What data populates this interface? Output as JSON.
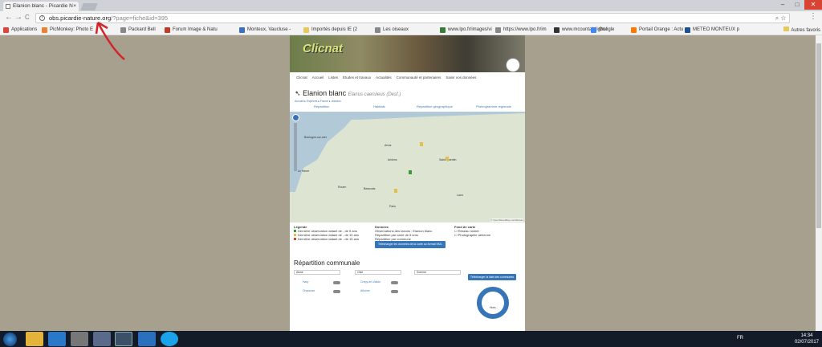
{
  "browser": {
    "tab_title": "Elanion blanc - Picardie N",
    "tab_close": "×",
    "address_host": "obs.picardie-nature.org",
    "address_rest": "/?page=fiche&id=395",
    "back_glyph": "←",
    "forward_glyph": "→",
    "reload_glyph": "C",
    "menu_glyph": "⋮",
    "omni_icons": "⌕ ☆",
    "win_min": "–",
    "win_max": "□",
    "win_close": "✕"
  },
  "bookmarks": [
    {
      "label": "Applications",
      "color": "#e0433a"
    },
    {
      "label": "PicMonkey: Photo E",
      "color": "#f08030"
    },
    {
      "label": "Packard Bell",
      "color": "#888888"
    },
    {
      "label": "Forum Image & Natu",
      "color": "#c23a2a"
    },
    {
      "label": "Monteux, Vaucluse -",
      "color": "#3a6fc2"
    },
    {
      "label": "Importés depuis IE (2",
      "color": "#e7c85a"
    },
    {
      "label": "Les oiseaux",
      "color": "#888888"
    },
    {
      "label": "www.lpo.fr/images/vi",
      "color": "#3c7a3c"
    },
    {
      "label": "https://www.lpo.fr/im",
      "color": "#888888"
    },
    {
      "label": "www.mcountainlight.f",
      "color": "#333333"
    },
    {
      "label": "Google",
      "color": "#4285f4"
    },
    {
      "label": "Portail Orange : Actu",
      "color": "#ff7900"
    },
    {
      "label": "METEO MONTEUX p",
      "color": "#1d4f91"
    }
  ],
  "bookmarks_other": "Autres favoris",
  "site": {
    "logo_text": "Clicnat",
    "nav": [
      "Clicnat",
      "Accueil",
      "Listes",
      "Études et travaux",
      "Actualités",
      "Communauté et partenaires",
      "Saisir vos données"
    ],
    "species_name": "Elanion blanc",
    "species_sci": "Elanus caeruleus (Desf.)",
    "sublinks": "Accueil  ▸ Espèces  ▸ Faune  ▸ oiseaux",
    "map_tabs": [
      "Répartition",
      "Habitats",
      "Répartition géographique",
      "Phénogramme régionale"
    ],
    "map_copyright": "© OpenStreetMap contributors",
    "cities": [
      {
        "name": "Boulogne-sur-mer"
      },
      {
        "name": "Arras"
      },
      {
        "name": "Amiens"
      },
      {
        "name": "Le Havre"
      },
      {
        "name": "Beauvais"
      },
      {
        "name": "Paris"
      },
      {
        "name": "Saint-Quentin"
      },
      {
        "name": "Rouen"
      },
      {
        "name": "Laon"
      }
    ],
    "legend_title": "Légende",
    "legend_items": [
      {
        "label": "Dernière observation datant de - de 5 ans",
        "color": "#3a9b3a"
      },
      {
        "label": "Dernière observation datant de - de 10 ans",
        "color": "#e0c24a"
      },
      {
        "label": "Dernière observation datant de - de 15 ans",
        "color": "#d04a2a"
      }
    ],
    "donnees_title": "Données",
    "donnees_lines": [
      "Observations des taxons : Elanion blanc",
      "Répartition par carré de 5 kms",
      "Répartition par commune"
    ],
    "donnees_button": "Télécharger les données de la carte au format KML",
    "fond_title": "Fond de carte",
    "fond_items": [
      "Réseau routier",
      "Photographie aérienne"
    ],
    "rc_title": "Répartition communale",
    "select_values": [
      "Aisne",
      "Oise",
      "Somme"
    ],
    "rc_button": "Télécharger la liste des communes",
    "communes": [
      {
        "name": "Hary"
      },
      {
        "name": "Chaourse"
      },
      {
        "name": "Crépy-en-Valois"
      },
      {
        "name": "Allonne"
      },
      {
        "name": "Villers-Cotterêts"
      }
    ],
    "donut_label": "Hors..."
  },
  "taskbar": {
    "lang": "FR",
    "time": "14:34",
    "date": "02/07/2017"
  }
}
